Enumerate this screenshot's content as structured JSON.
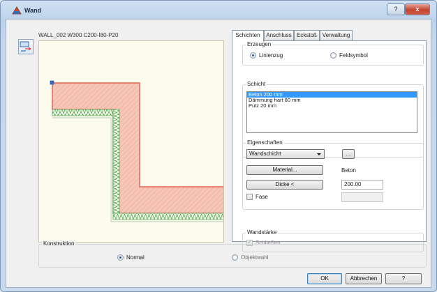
{
  "window": {
    "title": "Wand",
    "help_label": "?",
    "close_label": "x",
    "icon": "wall-app-icon"
  },
  "wall_type": "WALL_002 W300 C200-I80-P20",
  "tabs": [
    {
      "label": "Schichten",
      "active": true
    },
    {
      "label": "Anschluss",
      "active": false
    },
    {
      "label": "Eckstoß",
      "active": false
    },
    {
      "label": "Verwaltung",
      "active": false
    }
  ],
  "erzeugen": {
    "label": "Erzeugen",
    "options": [
      {
        "label": "Linienzug",
        "selected": true
      },
      {
        "label": "Feldsymbol",
        "selected": false
      }
    ]
  },
  "schicht": {
    "label": "Schicht",
    "items": [
      {
        "label": "Beton 200 mm",
        "selected": true
      },
      {
        "label": "Dämmung hart 80 mm",
        "selected": false
      },
      {
        "label": "Putz 20 mm",
        "selected": false
      }
    ]
  },
  "eigenschaften": {
    "label": "Eigenschaften",
    "type_value": "Wandschicht",
    "ellipsis_label": "...",
    "material_button": "Material...",
    "material_value": "Beton",
    "dicke_button": "Dicke <",
    "dicke_value": "200.00",
    "fase_label": "Fase",
    "fase_checked": false,
    "fase_value": ""
  },
  "wandstaerke": {
    "label": "Wandstärke",
    "schliessen_label": "Schließen",
    "schliessen_checked": true
  },
  "konstruktion": {
    "label": "Konstruktion",
    "options": [
      {
        "label": "Normal",
        "selected": true
      },
      {
        "label": "Objektwahl",
        "selected": false
      }
    ]
  },
  "buttons": {
    "ok": "OK",
    "cancel": "Abbrechen",
    "help": "?"
  },
  "colors": {
    "concrete_fill": "#f7c6b6",
    "concrete_stroke": "#e04a3a",
    "insulation": "#3d9a3d",
    "listbox_selection": "#3399ff"
  }
}
